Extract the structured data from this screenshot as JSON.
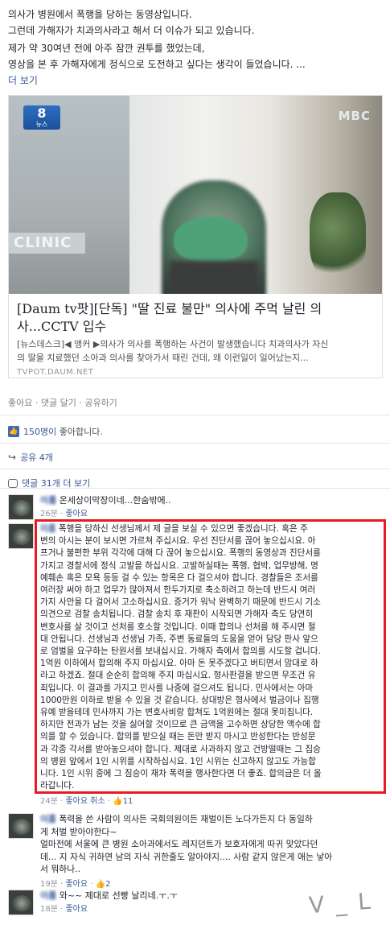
{
  "post": {
    "lines": [
      "의사가 병원에서 폭행을 당하는 동영상입니다.",
      "그런데 가해자가 치과의사라고 해서 더 이슈가 되고 있습니다.",
      "제가 약 30여년 전에 아주 잠깐 권투를 했었는데,",
      "영상을 본 후 가해자에게 정식으로 도전하고 싶다는 생각이 들었습니다. ..."
    ],
    "see_more": "더 보기"
  },
  "card": {
    "logo_number": "8",
    "logo_sub": "뉴스",
    "watermark": "MBC",
    "sign_text": "CLINIC",
    "title_lines": [
      "[Daum tv팟][단독] \"딸 진료 불만\" 의사에 주먹 날린 의",
      "사...CCTV 입수"
    ],
    "desc_lines": [
      "[뉴스데스크]◀ 앵커 ▶의사가 의사를 폭행하는 사건이 발생했습니다 치과의사가 자신",
      "의 딸을 치료했던 소아과 의사를 찾아가서 때린 건데, 왜 이런일이 일어났는지..."
    ],
    "domain": "TVPOT.DAUM.NET"
  },
  "actions": {
    "like": "좋아요",
    "comment": "댓글 달기",
    "share": "공유하기",
    "dot": "·"
  },
  "likes": {
    "count": "150명이",
    "suffix": " 좋아합니다."
  },
  "shares": {
    "label": "공유 4개"
  },
  "view_more": {
    "label": "댓글 31개 더 보기"
  },
  "comments": [
    {
      "name": "이름",
      "text_lines": [
        "온세상이막장이네...한숨밖에.."
      ],
      "time": "26분",
      "like": "좋아요"
    },
    {
      "name": "이름",
      "text_lines": [
        "폭행을 당하신 선생님께서 제 글을 보실 수 있으면 좋겠습니다. 혹은 주",
        "변의 아시는 분이 보시면 가르쳐 주십시요. 우선 진단서를 끊어 놓으십시요. 아",
        "프거나 불편한 부위 각각에 대해 다 끊어 놓으십시요. 폭행의 동영상과 진단서를",
        "가지고 경찰서에 정식 고발을 하십시요. 고발하실때는 폭행, 협박, 업무방해, 명",
        "예훼손 혹은 모욕 등등 걸 수 있는 항목은 다 걸으셔야 합니다. 경찰들은 조서를",
        "여러장 써야 하고 업무가 많아져서 한두가지로 축소하려고 하는데 반드시 여러",
        "가지 사안을 다 걸어서 고소하십시요. 증거가 워낙 완벽하기 때문에 반드시 기소",
        "의견으로 검찰 송치됩니다. 검찰 송치 후 재판이 시작되면 가해자 측도 당연히",
        "변호사를 살 것이고 선처를 호소할 것입니다. 이때 합의나 선처를 해 주시면 절",
        "대 안됩니다. 선생님과 선생님 가족, 주변 동료들의 도움을 얻어 담당 판사 앞으",
        "로 엄벌을 요구하는 탄원서를 보내십시요. 가해자 측에서 합의를 시도할 겁니다.",
        "1억원 이하에서 합의해 주지 마십시요. 아마 돈 못주겠다고 버티면서 맘대로 하",
        "라고 하겠죠. 절대 순순히 합의해 주지 마십시요. 형사판결을 받으면 무조건 유",
        "죄입니다. 이 결과를 가지고 민사를 나중에 걸으셔도 됩니다. 민사에서는 아마",
        "1000만원 이하로 받을 수 있을 것 같습니다. 상대방은 형사에서 벌금이나 집행",
        "유예 받을테데 민사까지 가는 변호사비랑 합쳐도 1억원에는 절대 못미칩니다.",
        "하지만 전과가 남는 것을 싫어할 것이므로 큰 금액을 고수하면 상당한 액수에 합",
        "의를 할 수 있습니다. 합의를 받으실 때는 돈만 받지 마시고 반성한다는 반성문",
        "과 각종 각서를 받아놓으셔야 합니다. 제대로 사과하지 않고 건방떨때는 그 집승",
        "의 병원 앞에서 1인 시위를 시작하십시요. 1인 시위는 신고하지 않고도 가능합",
        "니다. 1인 시위 중에 그 짐승이 재차 폭력을 행사한다면 더 좋죠. 합의금은 더 올",
        "라갑니다."
      ],
      "time": "24분",
      "like": "좋아요",
      "cancel": "취소",
      "like_count": "11"
    },
    {
      "name": "이름",
      "text_lines": [
        "폭력을 쓴 사람이 의사든 국회의원이든 재벌이든 노다가든지 다 동일하",
        "게 처벌 받아야한다~",
        "얼마전에 서울에 큰 병원 소아과에서도 레지던트가 보호자에게 따귀 맞았다던",
        "데... 지 자식 귀하면 남의 자식 귀한줄도 알아야지.... 사람 같지 않은게 애는 낳아",
        "서 뭐하나.."
      ],
      "time": "19분",
      "like": "좋아요",
      "like_count": "2"
    },
    {
      "name": "이름",
      "text_lines": [
        "와~~ 제대로 선빵 날리네.ㅜ.ㅜ"
      ],
      "time": "18분",
      "like": "좋아요"
    }
  ],
  "scribble": "V_L"
}
